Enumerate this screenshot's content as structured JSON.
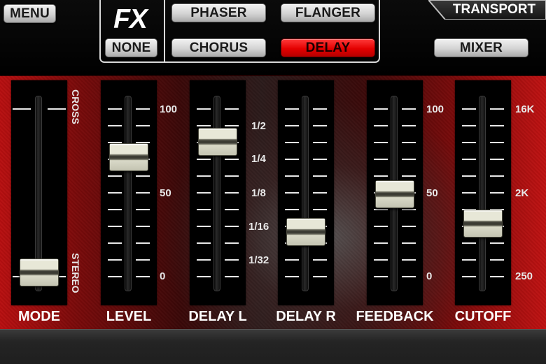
{
  "topbar": {
    "menu_label": "MENU",
    "fx_label": "FX",
    "effects": [
      {
        "label": "PHASER",
        "active": false
      },
      {
        "label": "FLANGER",
        "active": false
      },
      {
        "label": "NONE",
        "active": false
      },
      {
        "label": "CHORUS",
        "active": false
      },
      {
        "label": "DELAY",
        "active": true
      }
    ],
    "transport_label": "TRANSPORT",
    "mixer_label": "MIXER"
  },
  "colors": {
    "accent_active": "#e30000",
    "panel_red": "#b80f10",
    "button_gray": "#d3d3d3"
  },
  "channels": [
    {
      "label": "MODE",
      "value": 0.03,
      "scale_top": "CROSS",
      "scale_bottom": "STEREO"
    },
    {
      "label": "LEVEL",
      "value": 0.71,
      "scale": [
        "100",
        "50",
        "0"
      ]
    },
    {
      "label": "DELAY L",
      "value": 0.8,
      "scale": [
        "1/2",
        "1/4",
        "1/8",
        "1/16",
        "1/32"
      ]
    },
    {
      "label": "DELAY R",
      "value": 0.27
    },
    {
      "label": "FEEDBACK",
      "value": 0.49,
      "scale": [
        "100",
        "50",
        "0"
      ]
    },
    {
      "label": "CUTOFF",
      "value": 0.32,
      "scale": [
        "16K",
        "2K",
        "250"
      ]
    }
  ]
}
